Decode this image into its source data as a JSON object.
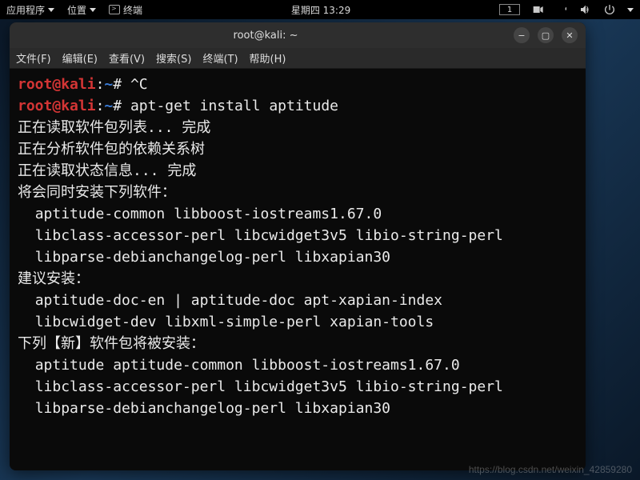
{
  "top_panel": {
    "apps": "应用程序",
    "places": "位置",
    "terminal": "终端",
    "datetime": "星期四 13:29",
    "workspace": "1"
  },
  "window": {
    "title": "root@kali: ~",
    "menus": {
      "file": "文件(F)",
      "edit": "编辑(E)",
      "view": "查看(V)",
      "search": "搜索(S)",
      "terminal": "终端(T)",
      "help": "帮助(H)"
    }
  },
  "prompt": {
    "user": "root",
    "host": "kali",
    "path": "~",
    "symbol": "#"
  },
  "terminal_lines": [
    {
      "type": "prompt",
      "cmd": "^C"
    },
    {
      "type": "prompt",
      "cmd": "apt-get install aptitude"
    },
    {
      "type": "out",
      "text": "正在读取软件包列表... 完成"
    },
    {
      "type": "out",
      "text": "正在分析软件包的依赖关系树"
    },
    {
      "type": "out",
      "text": "正在读取状态信息... 完成"
    },
    {
      "type": "out",
      "text": "将会同时安装下列软件："
    },
    {
      "type": "out",
      "text": "  aptitude-common libboost-iostreams1.67.0"
    },
    {
      "type": "out",
      "text": "  libclass-accessor-perl libcwidget3v5 libio-string-perl"
    },
    {
      "type": "out",
      "text": "  libparse-debianchangelog-perl libxapian30"
    },
    {
      "type": "out",
      "text": "建议安装："
    },
    {
      "type": "out",
      "text": "  aptitude-doc-en | aptitude-doc apt-xapian-index"
    },
    {
      "type": "out",
      "text": "  libcwidget-dev libxml-simple-perl xapian-tools"
    },
    {
      "type": "out",
      "text": "下列【新】软件包将被安装："
    },
    {
      "type": "out",
      "text": "  aptitude aptitude-common libboost-iostreams1.67.0"
    },
    {
      "type": "out",
      "text": "  libclass-accessor-perl libcwidget3v5 libio-string-perl"
    },
    {
      "type": "out",
      "text": "  libparse-debianchangelog-perl libxapian30"
    }
  ],
  "watermark": "https://blog.csdn.net/weixin_42859280"
}
